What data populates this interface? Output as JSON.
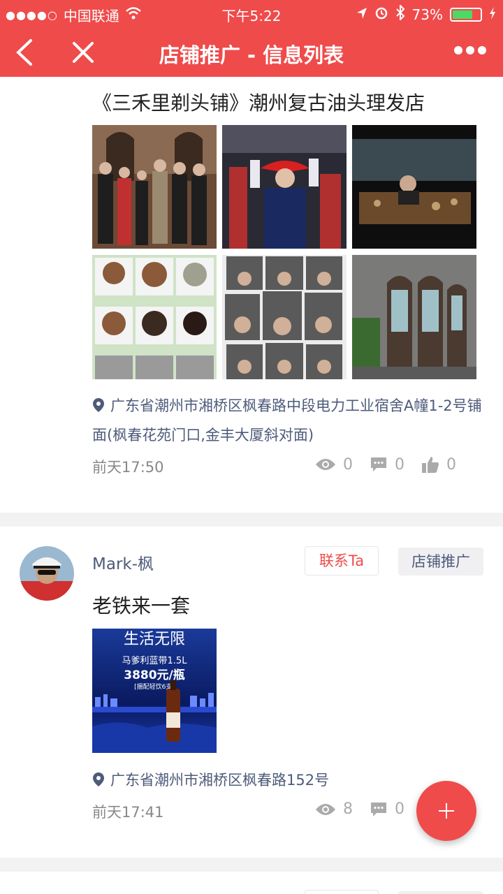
{
  "status_bar": {
    "signal": "●●●●○",
    "carrier": "中国联通",
    "time": "下午5:22",
    "battery_percent": "73%",
    "battery_level": 0.73,
    "icons": [
      "wifi-icon",
      "location-arrow-icon",
      "alarm-icon",
      "bluetooth-icon",
      "battery-icon",
      "charging-icon"
    ]
  },
  "nav": {
    "title": "店铺推广 - 信息列表",
    "back_icon": "chevron-left-icon",
    "close_icon": "close-icon",
    "more_icon": "more-dots-icon"
  },
  "posts": [
    {
      "title": "《三禾里剃头铺》潮州复古油头理发店",
      "images": [
        "group-photo",
        "fashion-show",
        "tea-table",
        "hairstyle-collage",
        "kids-haircuts",
        "shopfront-arches"
      ],
      "location": "广东省潮州市湘桥区枫春路中段电力工业宿舍A幢1-2号铺面(枫春花苑门口,金丰大厦斜对面)",
      "time": "前天17:50",
      "views": "0",
      "comments": "0",
      "likes": "0"
    },
    {
      "user": "Mark-枫",
      "contact_label": "联系Ta",
      "category": "店铺推广",
      "title": "老铁来一套",
      "images": [
        "liquor-ad"
      ],
      "ad_text_1": "生活无限",
      "ad_text_2": "马爹利蓝带1.5L",
      "ad_text_3": "3880元/瓶",
      "ad_text_4": "[捆配轻饮6支]",
      "location": "广东省潮州市湘桥区枫春路152号",
      "time": "前天17:41",
      "views": "8",
      "comments": "0"
    }
  ],
  "fab": {
    "icon": "plus-icon"
  },
  "colors": {
    "primary": "#ef4b4b",
    "link": "#4e5b7a",
    "muted": "#aaaaaa"
  }
}
